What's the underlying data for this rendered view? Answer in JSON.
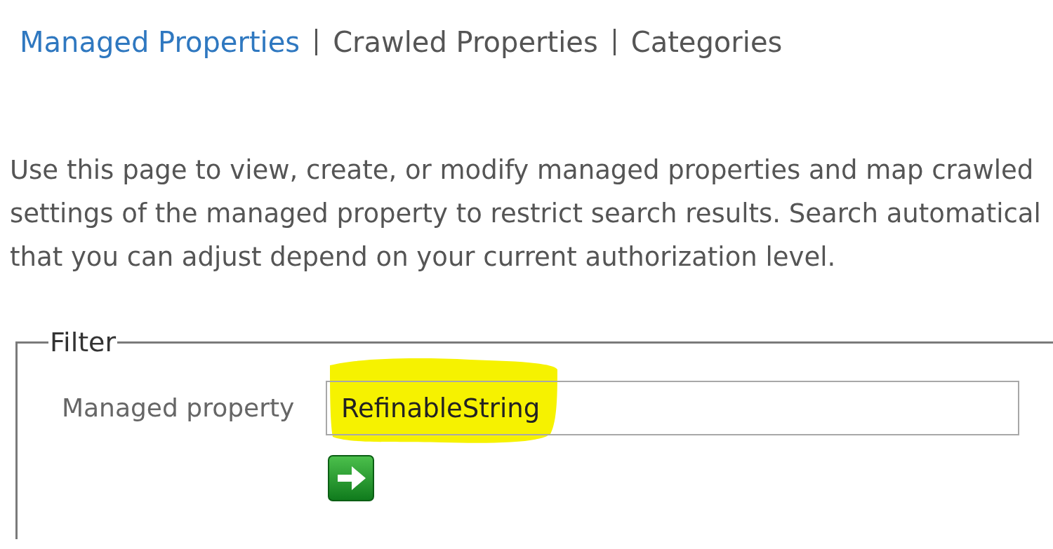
{
  "nav_links": [
    {
      "label": "Managed Properties",
      "selected": true
    },
    {
      "label": "Crawled Properties",
      "selected": false
    },
    {
      "label": "Categories",
      "selected": false
    }
  ],
  "description": {
    "lines": [
      "Use this page to view, create, or modify managed properties and map crawled",
      "settings of the managed property to restrict search results. Search automatical",
      "that you can adjust depend on your current authorization level."
    ]
  },
  "filter": {
    "legend": "Filter",
    "field": {
      "label": "Managed property",
      "value": "RefinableString",
      "highlighted": true
    }
  }
}
